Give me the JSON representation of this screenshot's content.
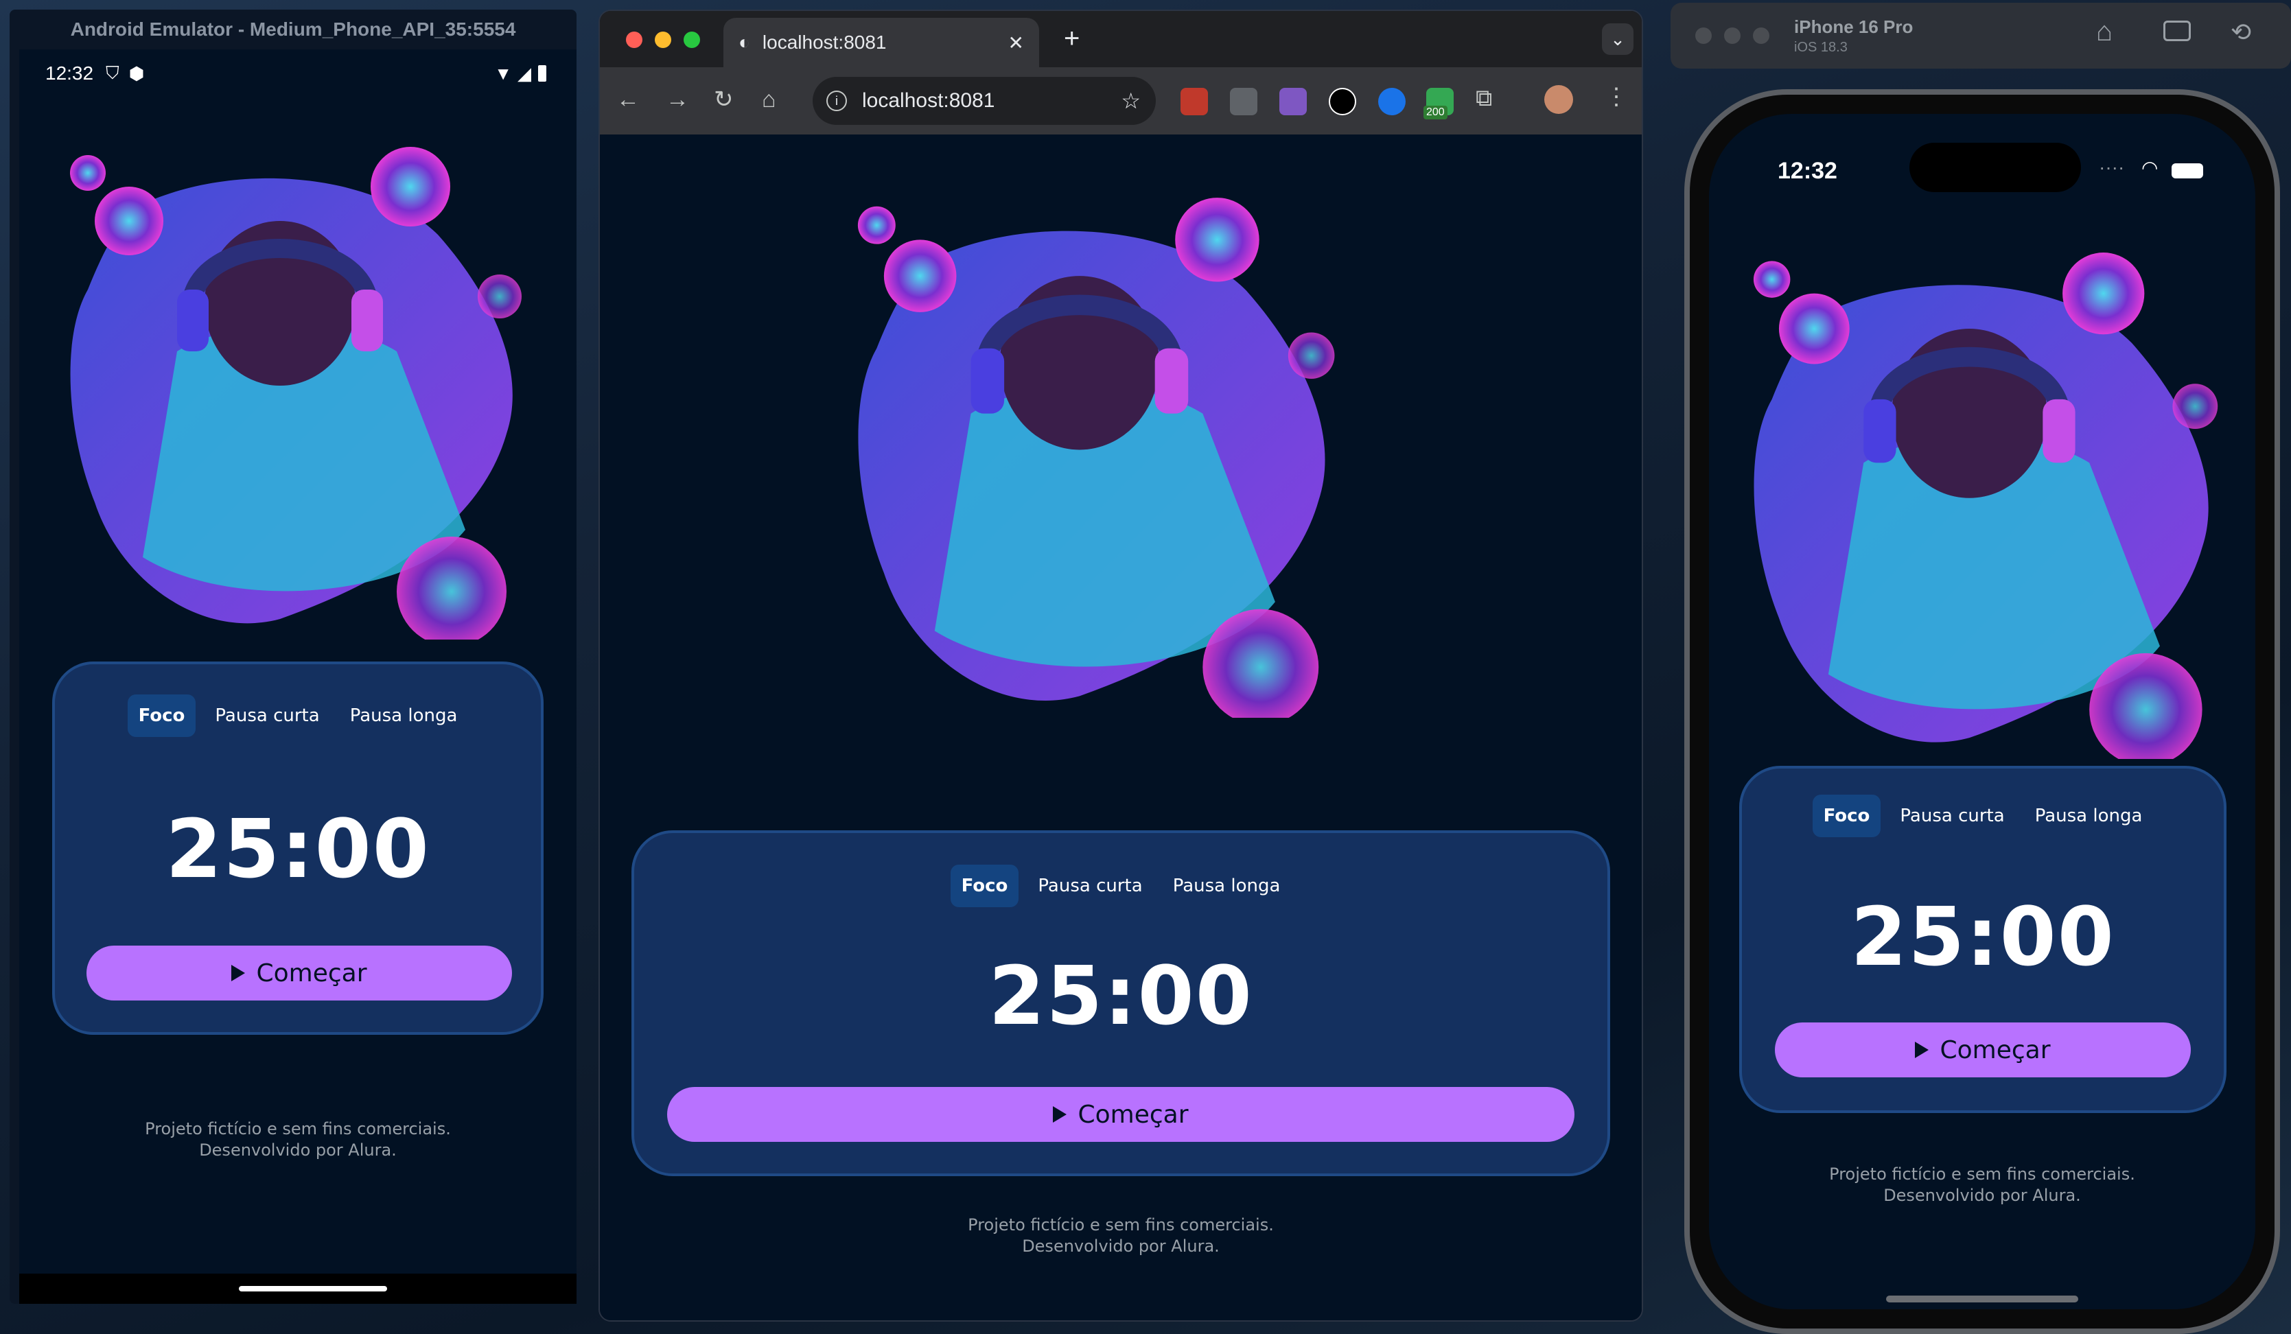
{
  "colors": {
    "app_bg": "#021123",
    "card_bg": "#14305f",
    "accent": "#b872ff",
    "active_tab": "#144480",
    "footer_text": "#98a0a8"
  },
  "android": {
    "window_title": "Android Emulator - Medium_Phone_API_35:5554",
    "time": "12:32",
    "status_icons": [
      "shield-icon",
      "badge-icon",
      "wifi-icon",
      "signal-icon",
      "battery-icon"
    ]
  },
  "chrome": {
    "tab_title": "localhost:8081",
    "url": "localhost:8081",
    "new_tab": "+",
    "badge_count": "200"
  },
  "simulator": {
    "device_name": "iPhone 16 Pro",
    "os": "iOS 18.3",
    "time": "12:32"
  },
  "app": {
    "tabs": [
      "Foco",
      "Pausa curta",
      "Pausa longa"
    ],
    "active_tab": "Foco",
    "timer": "25:00",
    "start_label": "Começar",
    "footer_line1": "Projeto fictício e sem fins comerciais.",
    "footer_line2": "Desenvolvido por Alura."
  }
}
